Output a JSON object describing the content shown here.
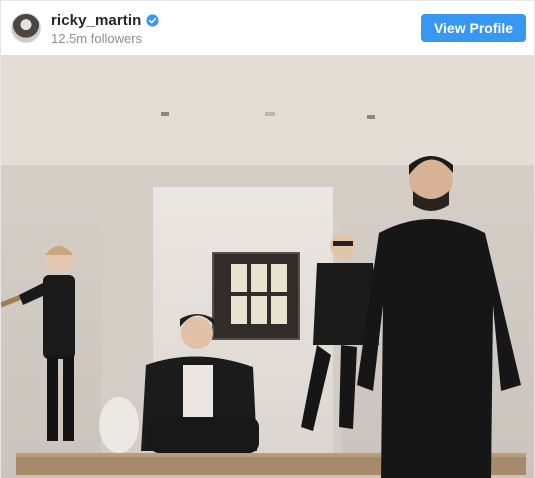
{
  "profile": {
    "username": "ricky_martin",
    "followers": "12.5m followers",
    "verified": true,
    "view_profile_label": "View Profile"
  },
  "icons": {
    "avatar": "profile-avatar",
    "verified": "verified-badge-icon"
  },
  "colors": {
    "accent": "#3897f0",
    "text": "#262626",
    "muted": "#8e8e8e"
  }
}
